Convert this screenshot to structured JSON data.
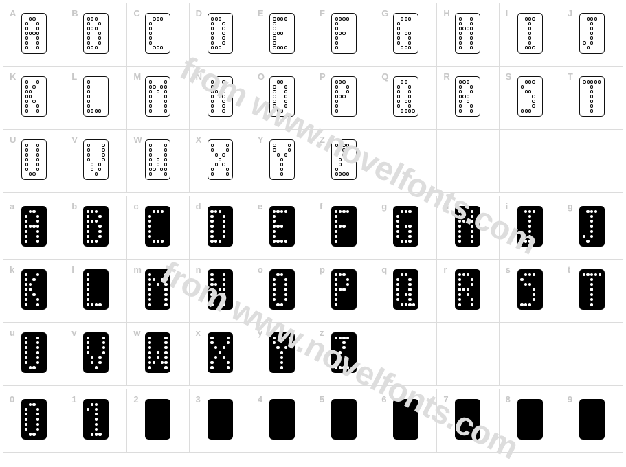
{
  "page": {
    "background_color": "#ffffff",
    "grid_line_color": "#dcdcdc",
    "label_color": "#c8c8c8",
    "glyph_outline_color": "#111111",
    "glyph_fill_color": "#000000",
    "watermark_color": "#dddddd"
  },
  "watermark": {
    "line1": "from www.novelfonts.com",
    "line2": "from www.novelfonts.com"
  },
  "blocks": [
    {
      "name": "uppercase",
      "style": "outline",
      "columns": 10,
      "cells": [
        {
          "label": "A",
          "has_glyph": true,
          "pattern": [
            "01100",
            "10010",
            "10010",
            "11110",
            "10010",
            "10010",
            "10010"
          ]
        },
        {
          "label": "B",
          "has_glyph": true,
          "pattern": [
            "11100",
            "10010",
            "11100",
            "10010",
            "10010",
            "10010",
            "11100"
          ]
        },
        {
          "label": "C",
          "has_glyph": true,
          "pattern": [
            "01110",
            "10000",
            "10000",
            "10000",
            "10000",
            "10000",
            "01110"
          ]
        },
        {
          "label": "D",
          "has_glyph": true,
          "pattern": [
            "11100",
            "10010",
            "10010",
            "10010",
            "10010",
            "10010",
            "11100"
          ]
        },
        {
          "label": "E",
          "has_glyph": true,
          "pattern": [
            "11110",
            "10000",
            "10000",
            "11100",
            "10000",
            "10000",
            "11110"
          ]
        },
        {
          "label": "F",
          "has_glyph": true,
          "pattern": [
            "11110",
            "10000",
            "10000",
            "11100",
            "10000",
            "10000",
            "10000"
          ]
        },
        {
          "label": "G",
          "has_glyph": true,
          "pattern": [
            "01110",
            "10000",
            "10000",
            "10110",
            "10010",
            "10010",
            "01110"
          ]
        },
        {
          "label": "H",
          "has_glyph": true,
          "pattern": [
            "10010",
            "10010",
            "11110",
            "10010",
            "10010",
            "10010",
            "10010"
          ]
        },
        {
          "label": "I",
          "has_glyph": true,
          "pattern": [
            "01110",
            "00100",
            "00100",
            "00100",
            "00100",
            "00100",
            "01110"
          ]
        },
        {
          "label": "J",
          "has_glyph": true,
          "pattern": [
            "01110",
            "00100",
            "00100",
            "00100",
            "00100",
            "10100",
            "01000"
          ]
        },
        {
          "label": "K",
          "has_glyph": true,
          "pattern": [
            "10010",
            "10100",
            "11000",
            "11000",
            "10100",
            "10010",
            "10010"
          ]
        },
        {
          "label": "L",
          "has_glyph": true,
          "pattern": [
            "10000",
            "10000",
            "10000",
            "10000",
            "10000",
            "10000",
            "11110"
          ]
        },
        {
          "label": "M",
          "has_glyph": true,
          "pattern": [
            "10001",
            "11011",
            "10101",
            "10001",
            "10001",
            "10001",
            "10001"
          ]
        },
        {
          "label": "N",
          "has_glyph": true,
          "pattern": [
            "10010",
            "10010",
            "11010",
            "10110",
            "10010",
            "10010",
            "10010"
          ]
        },
        {
          "label": "O",
          "has_glyph": true,
          "pattern": [
            "01100",
            "10010",
            "10010",
            "10010",
            "10010",
            "10010",
            "01100"
          ]
        },
        {
          "label": "P",
          "has_glyph": true,
          "pattern": [
            "11100",
            "10010",
            "10010",
            "11100",
            "10000",
            "10000",
            "10000"
          ]
        },
        {
          "label": "Q",
          "has_glyph": true,
          "pattern": [
            "01100",
            "10010",
            "10010",
            "10010",
            "10110",
            "10010",
            "01111"
          ]
        },
        {
          "label": "R",
          "has_glyph": true,
          "pattern": [
            "11100",
            "10010",
            "10010",
            "11100",
            "10100",
            "10010",
            "10010"
          ]
        },
        {
          "label": "S",
          "has_glyph": true,
          "pattern": [
            "01110",
            "10000",
            "01100",
            "00010",
            "00010",
            "00010",
            "11100"
          ]
        },
        {
          "label": "T",
          "has_glyph": true,
          "pattern": [
            "11111",
            "00100",
            "00100",
            "00100",
            "00100",
            "00100",
            "00100"
          ]
        },
        {
          "label": "U",
          "has_glyph": true,
          "pattern": [
            "10010",
            "10010",
            "10010",
            "10010",
            "10010",
            "10010",
            "01100"
          ]
        },
        {
          "label": "V",
          "has_glyph": true,
          "pattern": [
            "10001",
            "10001",
            "10001",
            "10001",
            "01010",
            "01010",
            "00100"
          ]
        },
        {
          "label": "W",
          "has_glyph": true,
          "pattern": [
            "10001",
            "10001",
            "10001",
            "10101",
            "10101",
            "11011",
            "10001"
          ]
        },
        {
          "label": "X",
          "has_glyph": true,
          "pattern": [
            "10001",
            "10001",
            "01010",
            "00100",
            "01010",
            "10001",
            "10001"
          ]
        },
        {
          "label": "Y",
          "has_glyph": true,
          "pattern": [
            "10001",
            "10001",
            "01010",
            "00100",
            "00100",
            "00100",
            "00100"
          ]
        },
        {
          "label": "Z",
          "has_glyph": true,
          "pattern": [
            "11110",
            "00100",
            "00100",
            "01000",
            "01000",
            "10000",
            "11110"
          ]
        },
        {
          "label": "",
          "has_glyph": false,
          "pattern": []
        },
        {
          "label": "",
          "has_glyph": false,
          "pattern": []
        },
        {
          "label": "",
          "has_glyph": false,
          "pattern": []
        },
        {
          "label": "",
          "has_glyph": false,
          "pattern": []
        }
      ]
    },
    {
      "name": "lowercase",
      "style": "solid",
      "columns": 10,
      "cells": [
        {
          "label": "a",
          "has_glyph": true,
          "pattern": [
            "01100",
            "10010",
            "10010",
            "11110",
            "10010",
            "10010",
            "10010"
          ]
        },
        {
          "label": "b",
          "has_glyph": true,
          "pattern": [
            "11100",
            "10010",
            "11100",
            "10010",
            "10010",
            "10010",
            "11100"
          ]
        },
        {
          "label": "c",
          "has_glyph": true,
          "pattern": [
            "01110",
            "10000",
            "10000",
            "10000",
            "10000",
            "10000",
            "01110"
          ]
        },
        {
          "label": "d",
          "has_glyph": true,
          "pattern": [
            "11100",
            "10010",
            "10010",
            "10010",
            "10010",
            "10010",
            "11100"
          ]
        },
        {
          "label": "e",
          "has_glyph": true,
          "pattern": [
            "11110",
            "10000",
            "10000",
            "11100",
            "10000",
            "10000",
            "11110"
          ]
        },
        {
          "label": "f",
          "has_glyph": true,
          "pattern": [
            "11110",
            "10000",
            "10000",
            "11100",
            "10000",
            "10000",
            "10000"
          ]
        },
        {
          "label": "g",
          "has_glyph": true,
          "pattern": [
            "01110",
            "10000",
            "10000",
            "10110",
            "10010",
            "10010",
            "01110"
          ]
        },
        {
          "label": "h",
          "has_glyph": true,
          "pattern": [
            "10010",
            "10010",
            "11110",
            "10010",
            "10010",
            "10010",
            "10010"
          ]
        },
        {
          "label": "i",
          "has_glyph": true,
          "pattern": [
            "01110",
            "00100",
            "00100",
            "00100",
            "00100",
            "00100",
            "01110"
          ]
        },
        {
          "label": "g",
          "has_glyph": true,
          "pattern": [
            "01110",
            "00100",
            "00100",
            "00100",
            "00100",
            "10100",
            "01000"
          ]
        },
        {
          "label": "k",
          "has_glyph": true,
          "pattern": [
            "10010",
            "10100",
            "11000",
            "11000",
            "10100",
            "10010",
            "10010"
          ]
        },
        {
          "label": "l",
          "has_glyph": true,
          "pattern": [
            "10000",
            "10000",
            "10000",
            "10000",
            "10000",
            "10000",
            "11110"
          ]
        },
        {
          "label": "m",
          "has_glyph": true,
          "pattern": [
            "10001",
            "11011",
            "10101",
            "10001",
            "10001",
            "10001",
            "10001"
          ]
        },
        {
          "label": "n",
          "has_glyph": true,
          "pattern": [
            "10010",
            "10010",
            "11010",
            "10110",
            "10010",
            "10010",
            "10010"
          ]
        },
        {
          "label": "o",
          "has_glyph": true,
          "pattern": [
            "01100",
            "10010",
            "10010",
            "10010",
            "10010",
            "10010",
            "01100"
          ]
        },
        {
          "label": "p",
          "has_glyph": true,
          "pattern": [
            "11100",
            "10010",
            "10010",
            "11100",
            "10000",
            "10000",
            "10000"
          ]
        },
        {
          "label": "q",
          "has_glyph": true,
          "pattern": [
            "01100",
            "10010",
            "10010",
            "10010",
            "10110",
            "10010",
            "01111"
          ]
        },
        {
          "label": "r",
          "has_glyph": true,
          "pattern": [
            "11100",
            "10010",
            "10010",
            "11100",
            "10100",
            "10010",
            "10010"
          ]
        },
        {
          "label": "s",
          "has_glyph": true,
          "pattern": [
            "01110",
            "10000",
            "01100",
            "00010",
            "00010",
            "00010",
            "11100"
          ]
        },
        {
          "label": "t",
          "has_glyph": true,
          "pattern": [
            "11111",
            "00100",
            "00100",
            "00100",
            "00100",
            "00100",
            "00100"
          ]
        },
        {
          "label": "u",
          "has_glyph": true,
          "pattern": [
            "10010",
            "10010",
            "10010",
            "10010",
            "10010",
            "10010",
            "01100"
          ]
        },
        {
          "label": "v",
          "has_glyph": true,
          "pattern": [
            "10001",
            "10001",
            "10001",
            "10001",
            "01010",
            "01010",
            "00100"
          ]
        },
        {
          "label": "w",
          "has_glyph": true,
          "pattern": [
            "10001",
            "10001",
            "10001",
            "10101",
            "10101",
            "11011",
            "10001"
          ]
        },
        {
          "label": "x",
          "has_glyph": true,
          "pattern": [
            "10001",
            "10001",
            "01010",
            "00100",
            "01010",
            "10001",
            "10001"
          ]
        },
        {
          "label": "y",
          "has_glyph": true,
          "pattern": [
            "10001",
            "10001",
            "01010",
            "00100",
            "00100",
            "00100",
            "00100"
          ]
        },
        {
          "label": "z",
          "has_glyph": true,
          "pattern": [
            "11110",
            "00100",
            "00100",
            "01000",
            "01000",
            "10000",
            "11110"
          ]
        },
        {
          "label": "",
          "has_glyph": false,
          "pattern": []
        },
        {
          "label": "",
          "has_glyph": false,
          "pattern": []
        },
        {
          "label": "",
          "has_glyph": false,
          "pattern": []
        },
        {
          "label": "",
          "has_glyph": false,
          "pattern": []
        }
      ]
    },
    {
      "name": "digits",
      "style": "solid",
      "columns": 10,
      "cells": [
        {
          "label": "0",
          "has_glyph": true,
          "pattern": [
            "01100",
            "10010",
            "10010",
            "10010",
            "10010",
            "10010",
            "01100"
          ]
        },
        {
          "label": "1",
          "has_glyph": true,
          "pattern": [
            "01100",
            "10100",
            "00100",
            "00100",
            "00100",
            "00100",
            "01110"
          ]
        },
        {
          "label": "2",
          "has_glyph": true,
          "pattern": [
            "00000",
            "00000",
            "00000",
            "00000",
            "00000",
            "00000",
            "00000"
          ]
        },
        {
          "label": "3",
          "has_glyph": true,
          "pattern": [
            "00000",
            "00000",
            "00000",
            "00000",
            "00000",
            "00000",
            "00000"
          ]
        },
        {
          "label": "4",
          "has_glyph": true,
          "pattern": [
            "00000",
            "00000",
            "00000",
            "00000",
            "00000",
            "00000",
            "00000"
          ]
        },
        {
          "label": "5",
          "has_glyph": true,
          "pattern": [
            "00000",
            "00000",
            "00000",
            "00000",
            "00000",
            "00000",
            "00000"
          ]
        },
        {
          "label": "6",
          "has_glyph": true,
          "pattern": [
            "00000",
            "00000",
            "00000",
            "00000",
            "00000",
            "00000",
            "00000"
          ]
        },
        {
          "label": "7",
          "has_glyph": true,
          "pattern": [
            "00000",
            "00000",
            "00000",
            "00000",
            "00000",
            "00000",
            "00000"
          ]
        },
        {
          "label": "8",
          "has_glyph": true,
          "pattern": [
            "00000",
            "00000",
            "00000",
            "00000",
            "00000",
            "00000",
            "00000"
          ]
        },
        {
          "label": "9",
          "has_glyph": true,
          "pattern": [
            "00000",
            "00000",
            "00000",
            "00000",
            "00000",
            "00000",
            "00000"
          ]
        }
      ]
    }
  ]
}
